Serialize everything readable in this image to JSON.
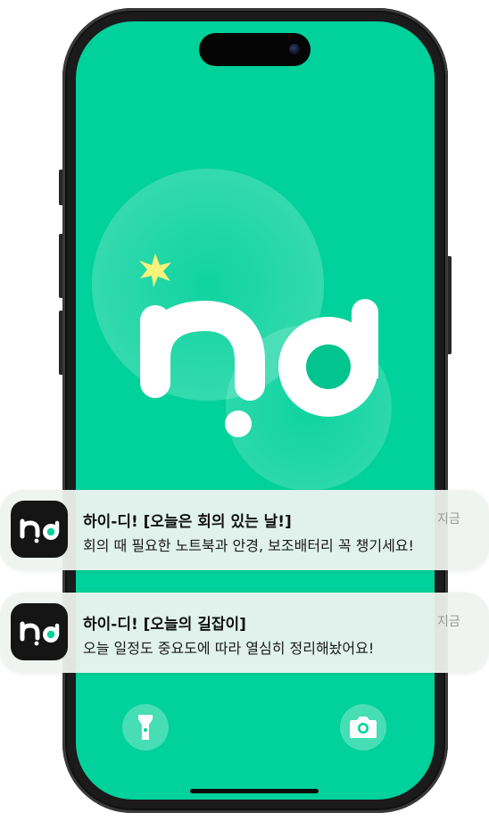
{
  "lockscreen": {
    "wallpaper_logo": "hd",
    "accent_color": "#01d19a",
    "star_color": "#f6f27a",
    "flashlight_icon": "flashlight-icon",
    "camera_icon": "camera-icon"
  },
  "notifications": [
    {
      "app_icon": "hd-app-icon",
      "title": "하이-디! [오늘은 회의 있는 날!]",
      "body": "회의 때 필요한 노트북과 안경, 보조배터리 꼭 챙기세요!",
      "time": "지금"
    },
    {
      "app_icon": "hd-app-icon",
      "title": "하이-디! [오늘의 길잡이]",
      "body": "오늘 일정도 중요도에 따라 열심히 정리해놨어요!",
      "time": "지금"
    }
  ]
}
